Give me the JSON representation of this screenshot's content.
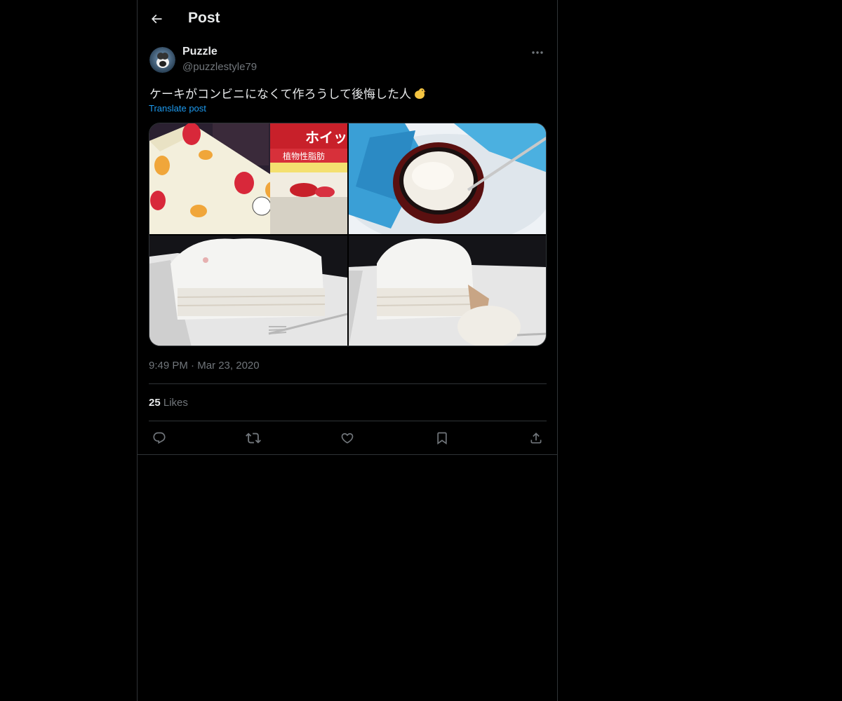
{
  "header": {
    "title": "Post",
    "back_icon": "arrow-left-icon"
  },
  "author": {
    "name": "Puzzle",
    "handle": "@puzzlestyle79"
  },
  "post": {
    "text": "ケーキがコンビニになくて作ろうして後悔した人",
    "emoji": "chick-emoji",
    "translate_label": "Translate post",
    "time": "9:49 PM",
    "separator": "·",
    "date": "Mar 23, 2020"
  },
  "media": {
    "images": [
      "cake-and-cream-package-photo",
      "whipped-cream-bowl-photo",
      "homemade-cake-photo",
      "homemade-cake-cut-photo"
    ],
    "package_text": "ホイッ",
    "package_subtext": "植物性脂肪"
  },
  "stats": {
    "likes_count": "25",
    "likes_label": "Likes"
  },
  "actions": [
    "reply-icon",
    "repost-icon",
    "like-icon",
    "bookmark-icon",
    "share-icon"
  ],
  "colors": {
    "background": "#000000",
    "text": "#e7e9ea",
    "muted": "#71767b",
    "link": "#1d9bf0",
    "border": "#2f3336"
  }
}
